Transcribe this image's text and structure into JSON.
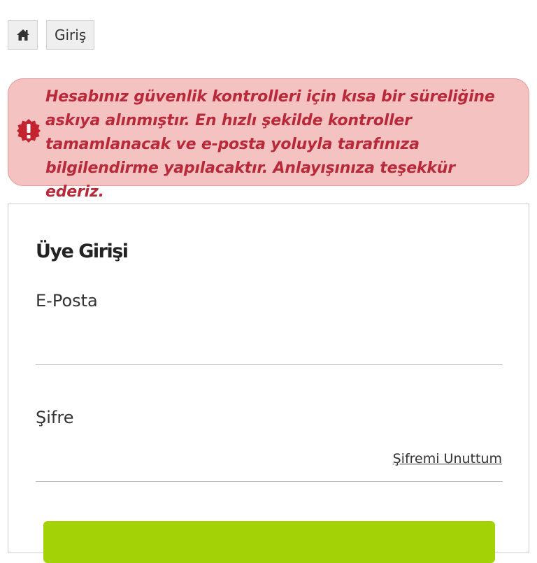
{
  "breadcrumb": {
    "home_icon": "home-icon",
    "items": [
      {
        "label": "Giriş"
      }
    ]
  },
  "alert": {
    "icon": "exclamation-badge-icon",
    "message": "Hesabınız güvenlik kontrolleri için kısa bir süreliğine askıya alınmıştır. En hızlı şekilde kontroller tamamlanacak ve e-posta yoluyla tarafınıza bilgilendirme yapılacaktır. Anlayışınıza teşekkür ederiz.",
    "text_color": "#b8293a",
    "background": "#f5c2c2"
  },
  "login": {
    "title": "Üye Girişi",
    "email_label": "E-Posta",
    "email_value": "",
    "password_label": "Şifre",
    "password_value": "",
    "forgot_link": "Şifremi Unuttum",
    "submit_color": "#a3d207"
  }
}
